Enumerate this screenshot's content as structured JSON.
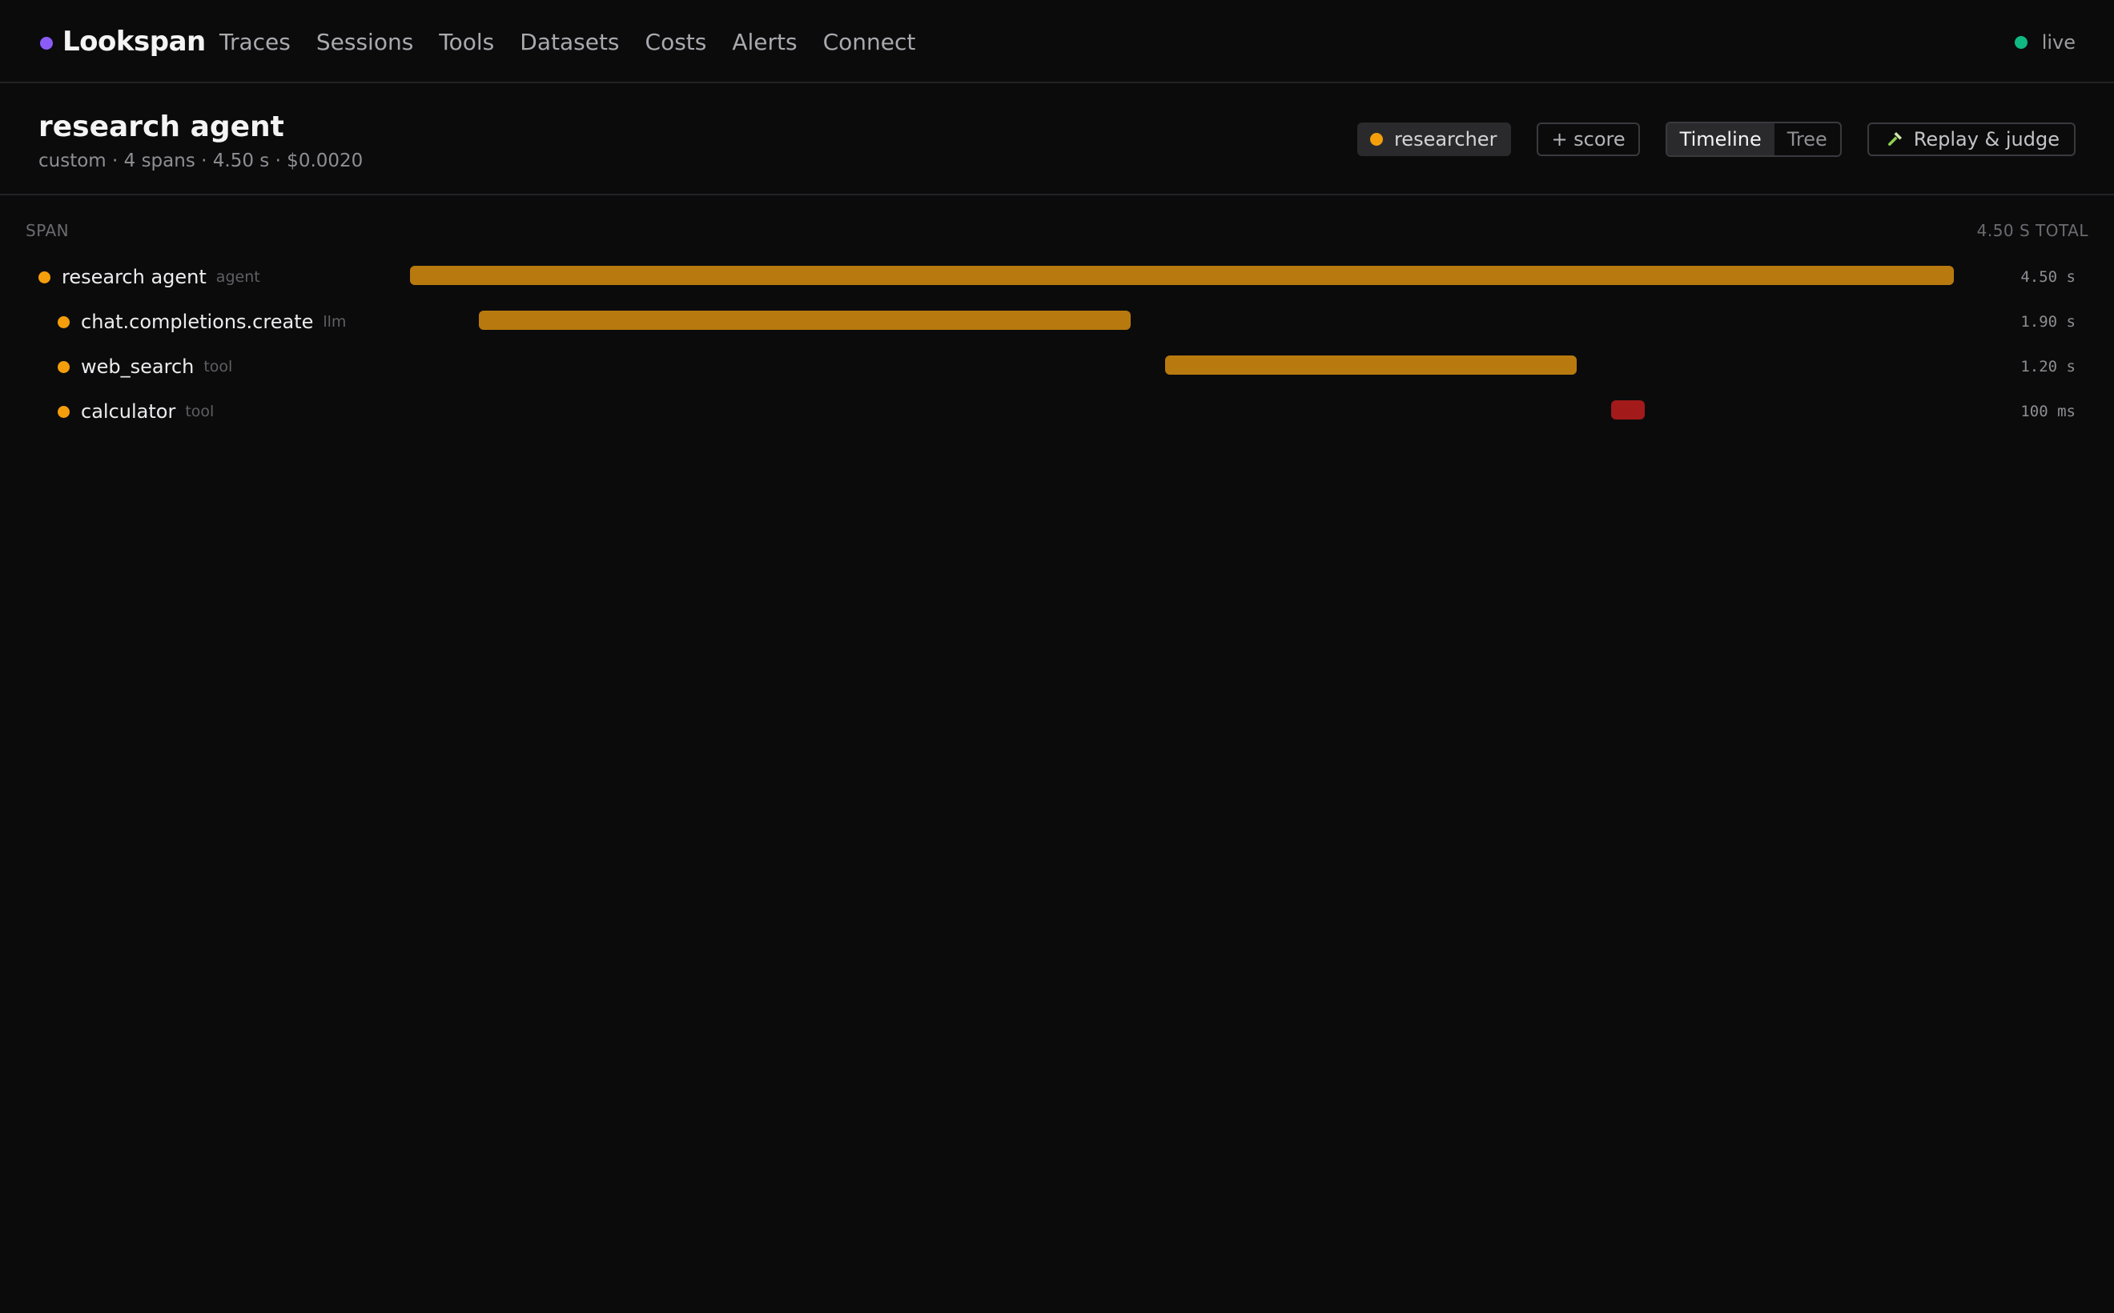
{
  "app": {
    "name": "Lookspan",
    "brand_color": "#8b5cf6",
    "nav": [
      "Traces",
      "Sessions",
      "Tools",
      "Datasets",
      "Costs",
      "Alerts",
      "Connect"
    ],
    "status": {
      "label": "live",
      "color": "#10b981"
    }
  },
  "trace": {
    "title": "research agent",
    "meta": "custom · 4 spans · 4.50 s · $0.0020",
    "agent_badge": {
      "label": "researcher",
      "color": "#f59e0b"
    },
    "score_label": "+ score",
    "views": [
      {
        "label": "Timeline",
        "active": true
      },
      {
        "label": "Tree",
        "active": false
      }
    ],
    "replay_label": "Replay & judge",
    "replay_icon": "hammer-icon"
  },
  "timeline": {
    "span_header": "Span",
    "total_header": "4.50 s total",
    "total_seconds": 4.5,
    "colors": {
      "ok": "#b87a0f",
      "error": "#a31a1a",
      "dot": "#f59e0b"
    },
    "spans": [
      {
        "name": "research agent",
        "kind": "agent",
        "depth": 0,
        "start_s": 0.0,
        "duration_s": 4.5,
        "duration_label": "4.50 s",
        "status": "ok"
      },
      {
        "name": "chat.completions.create",
        "kind": "llm",
        "depth": 1,
        "start_s": 0.2,
        "duration_s": 1.9,
        "duration_label": "1.90 s",
        "status": "ok"
      },
      {
        "name": "web_search",
        "kind": "tool",
        "depth": 1,
        "start_s": 2.2,
        "duration_s": 1.2,
        "duration_label": "1.20 s",
        "status": "ok"
      },
      {
        "name": "calculator",
        "kind": "tool",
        "depth": 1,
        "start_s": 3.5,
        "duration_s": 0.1,
        "duration_label": "100 ms",
        "status": "error"
      }
    ]
  }
}
